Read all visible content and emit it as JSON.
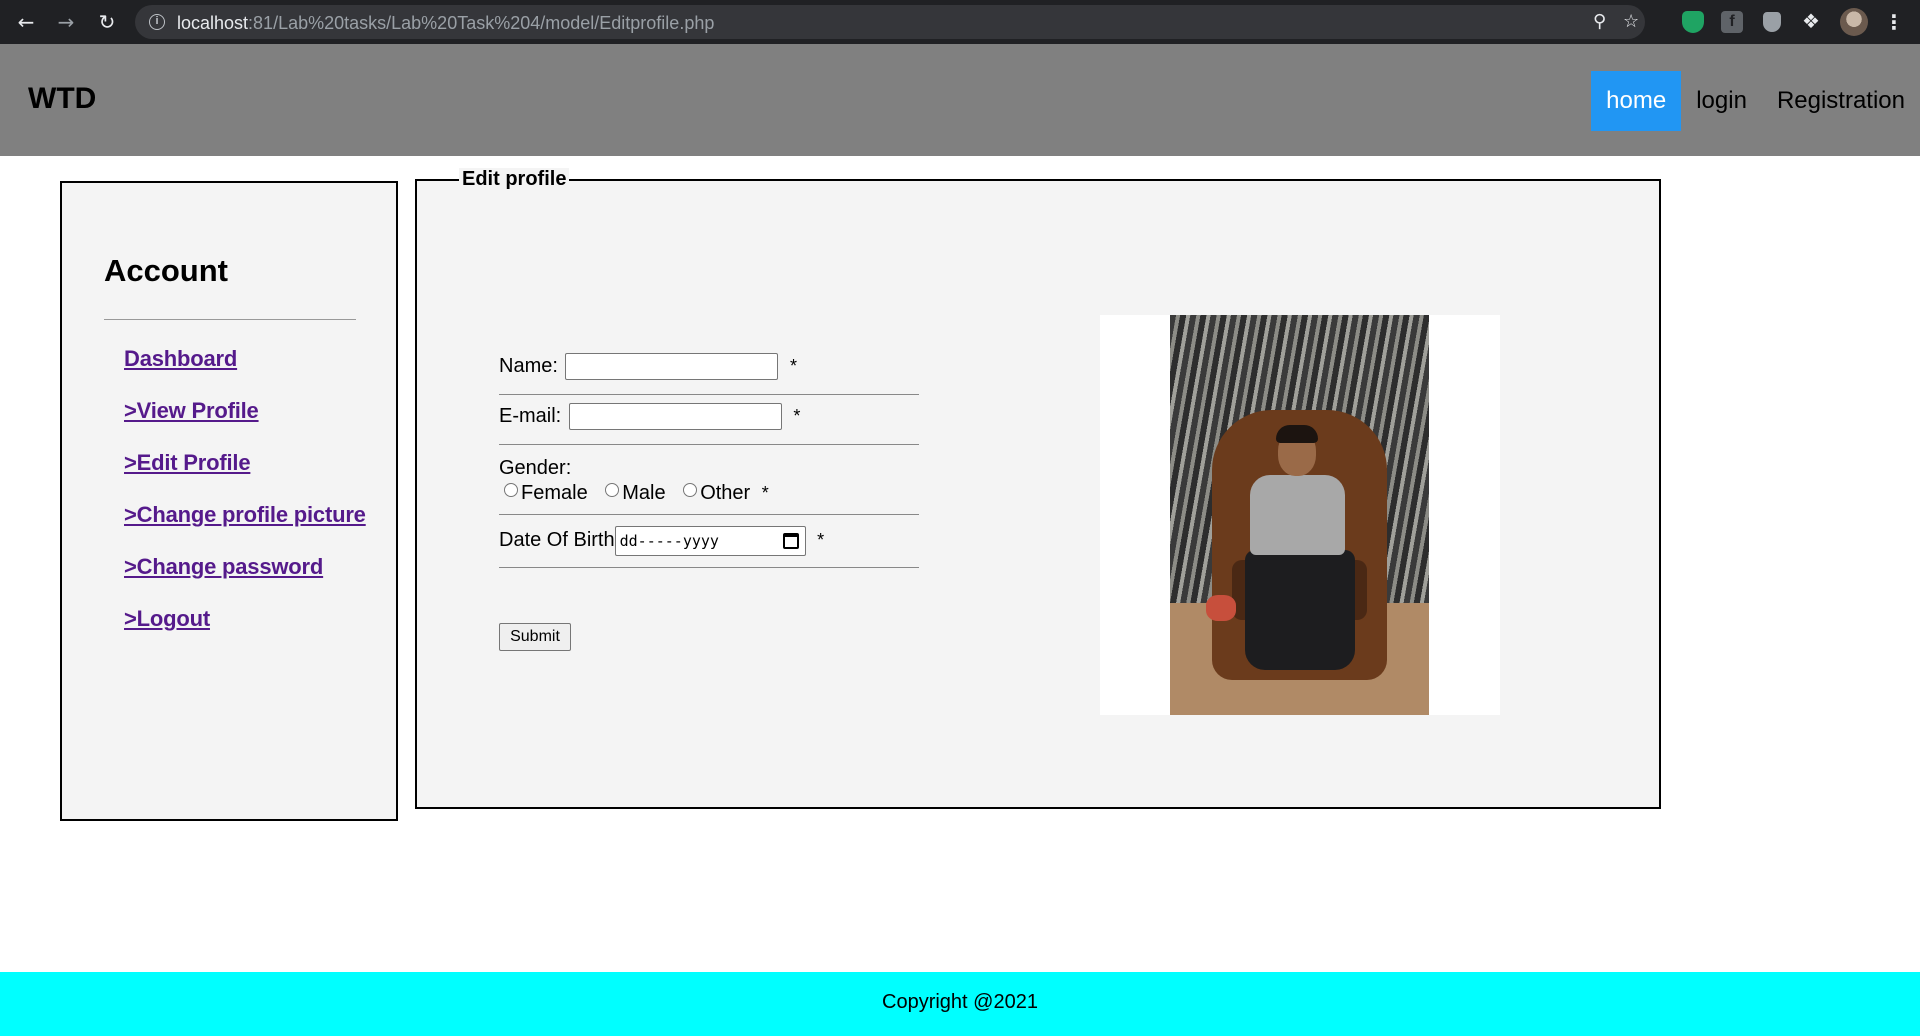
{
  "browser": {
    "url_host": "localhost",
    "url_path": ":81/Lab%20tasks/Lab%20Task%204/model/Editprofile.php"
  },
  "header": {
    "logo": "WTD",
    "nav": [
      {
        "label": "home",
        "active": true
      },
      {
        "label": "login",
        "active": false
      },
      {
        "label": "Registration",
        "active": false
      }
    ]
  },
  "sidebar": {
    "title": "Account",
    "items": [
      {
        "label": "Dashboard"
      },
      {
        "label": ">View Profile"
      },
      {
        "label": ">Edit Profile"
      },
      {
        "label": ">Change profile picture"
      },
      {
        "label": ">Change password"
      },
      {
        "label": ">Logout"
      }
    ]
  },
  "form": {
    "legend": "Edit profile",
    "name_label": "Name:",
    "name_value": "",
    "email_label": "E-mail:",
    "email_value": "",
    "required_mark": "*",
    "gender_label": "Gender:",
    "gender_options": [
      "Female",
      "Male",
      "Other"
    ],
    "dob_label": "Date Of Birth",
    "dob_placeholder": "dd-----yyyy",
    "submit_label": "Submit"
  },
  "footer": {
    "text": "Copyright @2021"
  },
  "colors": {
    "header_bg": "#808080",
    "nav_active_bg": "#2196f3",
    "footer_bg": "#00ffff",
    "link_color": "#551a8b"
  }
}
